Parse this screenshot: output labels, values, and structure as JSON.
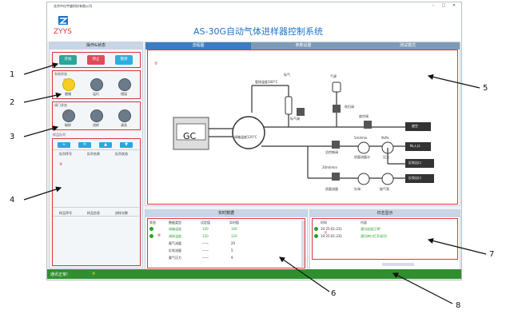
{
  "window": {
    "company": "北京中仪宇盛科技有限公司",
    "app_title": "AS-30G自动气体进样器控制系统",
    "logo_text": "ZYYS",
    "controls": [
      "–",
      "□",
      "✕"
    ]
  },
  "left_panel": {
    "title": "操作&状态",
    "buttons": [
      "开始",
      "停止",
      "暂停"
    ],
    "system_status_label": "系统状态",
    "system_status": [
      "就绪",
      "运行",
      "错误"
    ],
    "valve_status_label": "阀门状态",
    "valve_status": [
      "取样",
      "进样",
      "清洗"
    ],
    "queue_label": "样品队列",
    "queue_buttons": [
      "+",
      "✕",
      "▲",
      "▼"
    ],
    "queue_headers": [
      "队列序号",
      "队列名称",
      "队列状态"
    ],
    "sample_headers": [
      "样品序号",
      "样品信息",
      "进样次数"
    ],
    "marker_2": "②",
    "marker_3": "③",
    "marker_4": "④"
  },
  "main_panel": {
    "tabs": [
      "流程图",
      "参数设置",
      "测试模式"
    ],
    "marker_5": "⑤",
    "diagram": {
      "gc": "GC",
      "oven": "阀箱温度120°C",
      "valve_temp": "管线温度100°C",
      "standard_gas": "标气",
      "standard_valve": "标气阀",
      "carrier": "气源",
      "purge_valve": "吹扫阀",
      "vent_valve": "放空阀",
      "vent": "放空",
      "n2_in": "N₂入口",
      "back_out": "反吹出口",
      "back_out2": "反吹出口",
      "flow1": "5ml/min",
      "flow2": "20ml/min",
      "pressure": "9kPa",
      "flowmeter1": "质量流量计",
      "pressure_label": "压力",
      "ctrl_valve": "总控制阀",
      "ctrl_valve2": "总控制阀2",
      "needle": "针阀",
      "pump": "抽气泵",
      "flowmeter2": "质量流量"
    }
  },
  "realtime": {
    "title": "实时数据",
    "marker_6": "⑥",
    "headers": [
      "状态",
      "数据类型",
      "设定值",
      "实时值"
    ],
    "rows": [
      {
        "ok": true,
        "type": "阀箱温度",
        "set": "100",
        "real": "100",
        "green": true
      },
      {
        "ok": true,
        "type": "阀体温度",
        "set": "120",
        "real": "120",
        "green": true
      },
      {
        "ok": false,
        "type": "载气流量",
        "set": "——",
        "real": "20",
        "green": false
      },
      {
        "ok": false,
        "type": "反吹流量",
        "set": "——",
        "real": "5",
        "green": false
      },
      {
        "ok": false,
        "type": "载气压力",
        "set": "——",
        "real": "9",
        "green": false
      }
    ]
  },
  "log": {
    "title": "日志显示",
    "marker_7": "⑦",
    "headers": [
      "时间",
      "内容"
    ],
    "rows": [
      {
        "time": "10:25:01:231",
        "text": "通讯连接正常!"
      },
      {
        "time": "10:25:01:231",
        "text": "通讯串口打开成功!"
      }
    ]
  },
  "status_bar": {
    "text": "通讯正常!",
    "marker_8": "⑧"
  },
  "callouts": [
    "1",
    "2",
    "3",
    "4",
    "5",
    "6",
    "7",
    "8"
  ],
  "colors": {
    "start": "#2aa69a",
    "stop": "#e04a5a",
    "pause": "#2ab0e0",
    "tab_active": "#3a7cc0",
    "tab_inactive": "#7d9bb8",
    "status_bar": "#2f8f2f",
    "annotation_red": "#d9363e"
  }
}
